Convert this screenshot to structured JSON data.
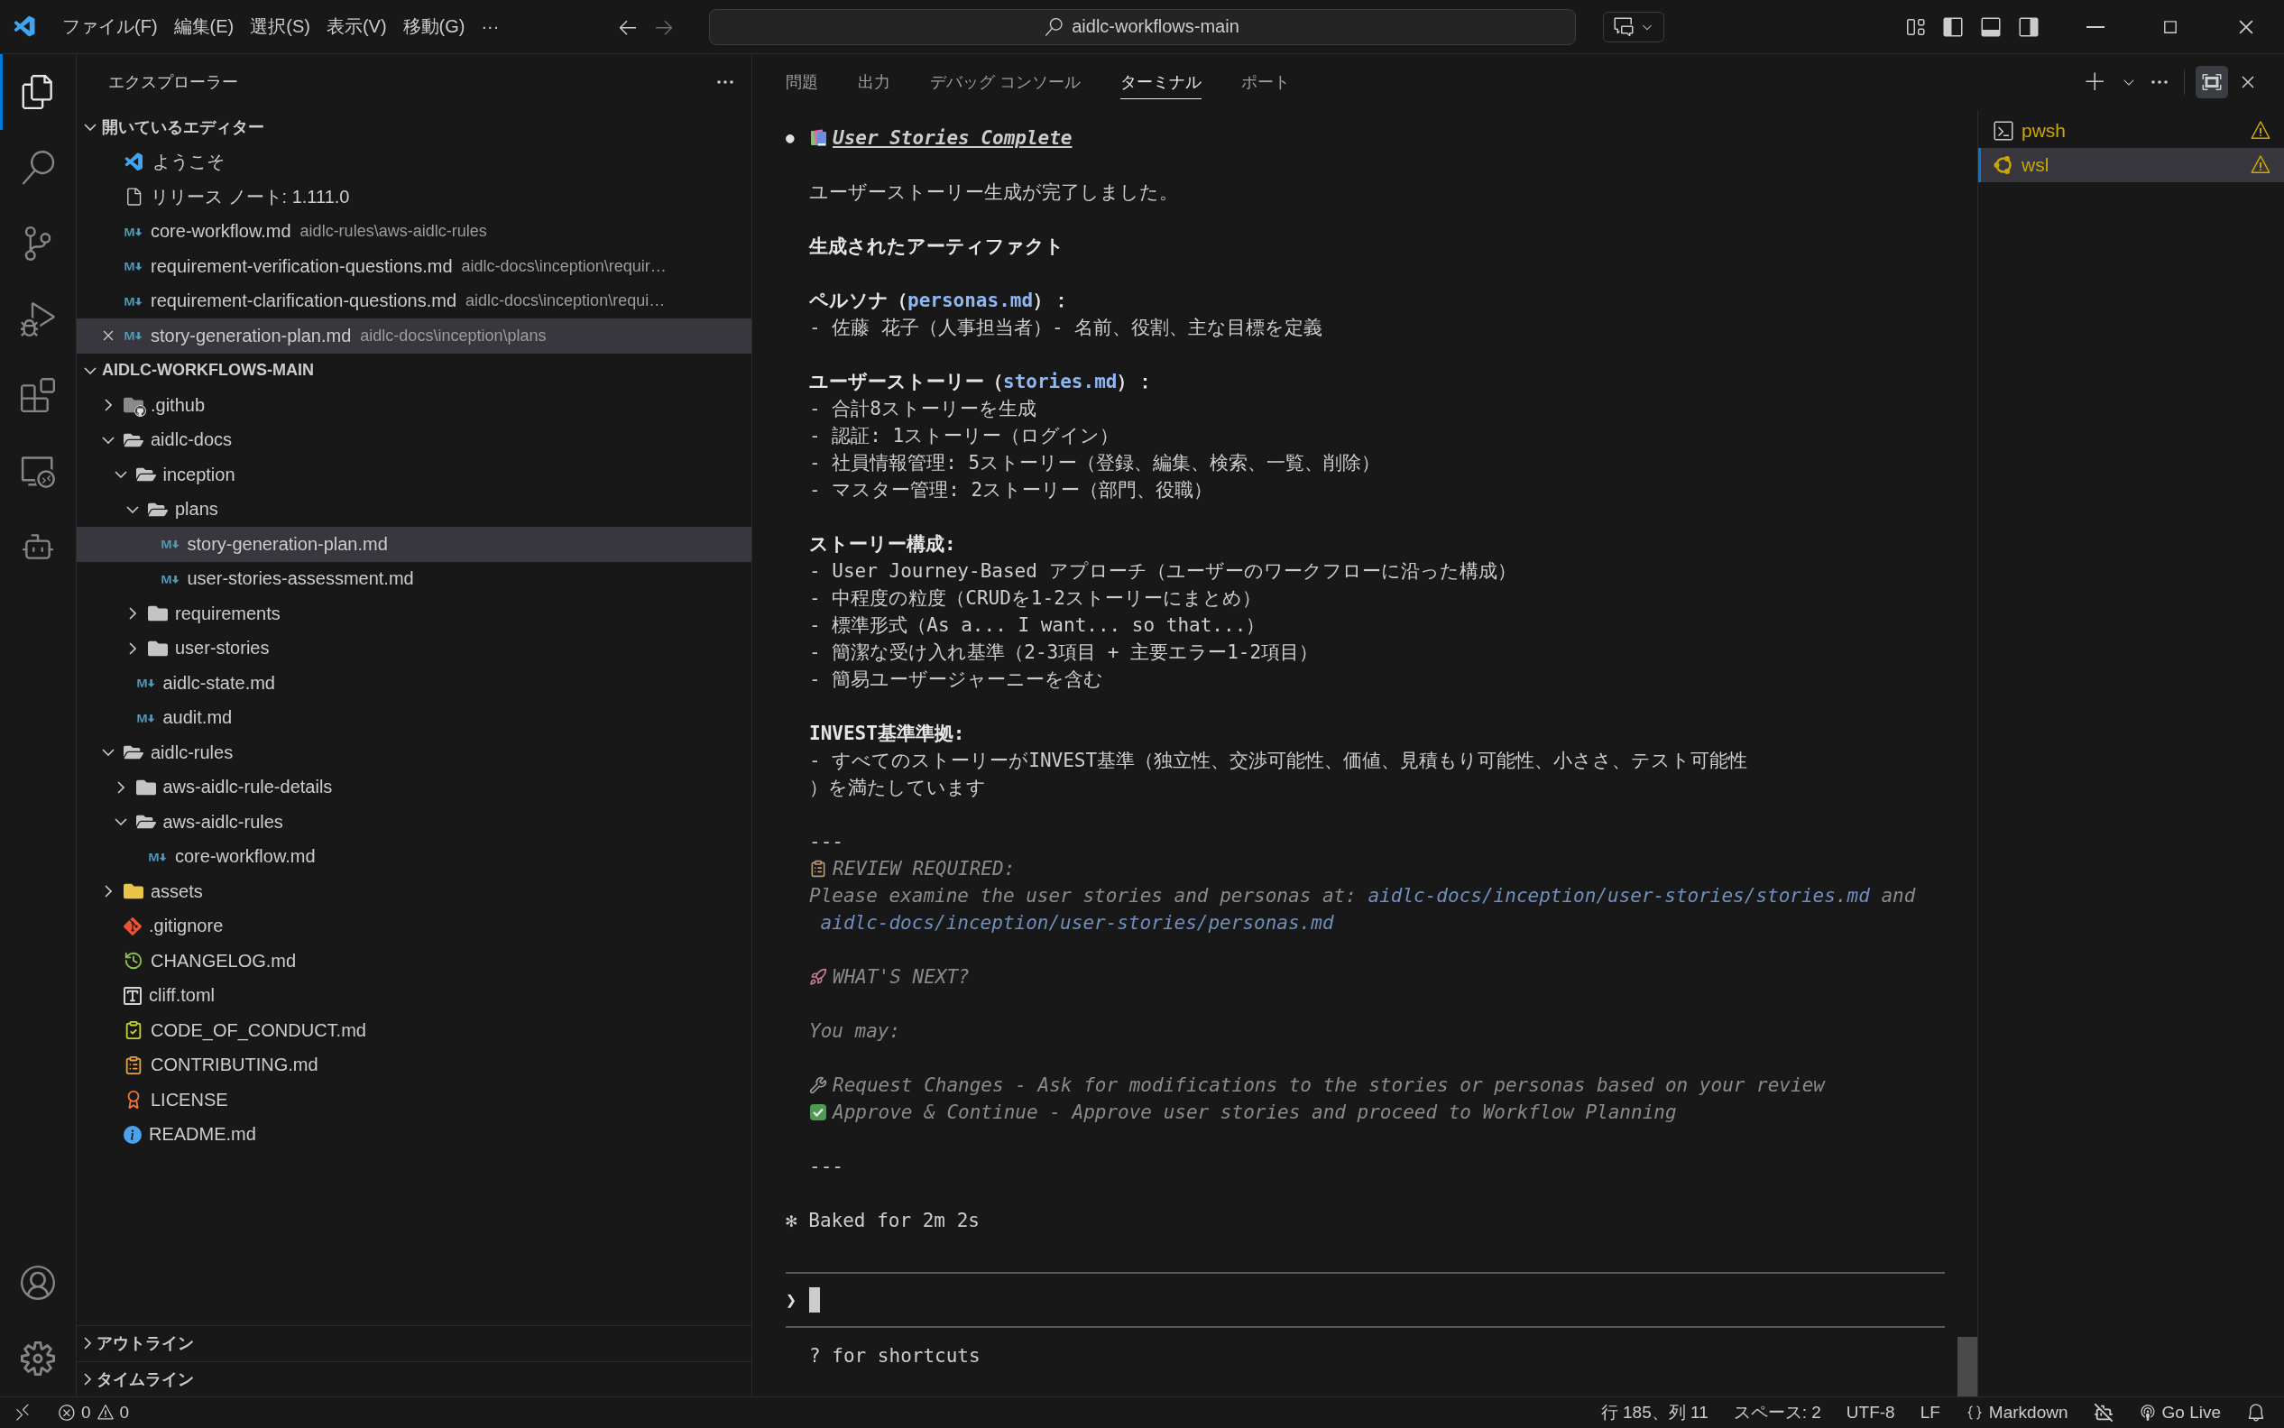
{
  "title_bar": {
    "menus": [
      "ファイル(F)",
      "編集(E)",
      "選択(S)",
      "表示(V)",
      "移動(G)"
    ],
    "more": "···",
    "search": "aidlc-workflows-main"
  },
  "activity_bar": {
    "top": [
      {
        "kind": "explorer",
        "selected": true
      },
      {
        "kind": "search",
        "selected": false
      },
      {
        "kind": "source_control",
        "selected": false
      },
      {
        "kind": "run_debug",
        "selected": false
      },
      {
        "kind": "extensions",
        "selected": false
      },
      {
        "kind": "remote",
        "selected": false
      },
      {
        "kind": "bot",
        "selected": false
      }
    ],
    "bottom": [
      {
        "kind": "account"
      },
      {
        "kind": "settings"
      }
    ]
  },
  "sidebar": {
    "title": "エクスプローラー",
    "open_editors": {
      "title": "開いているエディター",
      "expanded": true,
      "items": [
        {
          "name": "ようこそ",
          "kind": "welcome",
          "selected": false
        },
        {
          "name": "リリース ノート: 1.111.0",
          "kind": "file",
          "selected": false
        },
        {
          "name": "core-workflow.md",
          "path": "aidlc-rules\\aws-aidlc-rules",
          "kind": "markdown",
          "selected": false
        },
        {
          "name": "requirement-verification-questions.md",
          "path": "aidlc-docs\\inception\\requir…",
          "kind": "markdown",
          "selected": false
        },
        {
          "name": "requirement-clarification-questions.md",
          "path": "aidlc-docs\\inception\\requi…",
          "kind": "markdown",
          "selected": false
        },
        {
          "name": "story-generation-plan.md",
          "path": "aidlc-docs\\inception\\plans",
          "kind": "markdown",
          "selected": true
        }
      ]
    },
    "workspace": {
      "title": "AIDLC-WORKFLOWS-MAIN",
      "expanded": true,
      "items": [
        {
          "name": ".github",
          "kind": "folder_github",
          "expanded": false,
          "selected": false
        },
        {
          "name": "aidlc-docs",
          "kind": "folder",
          "expanded": true,
          "selected": false,
          "children": [
            {
              "name": "inception",
              "kind": "folder",
              "expanded": true,
              "selected": false,
              "children": [
                {
                  "name": "plans",
                  "kind": "folder",
                  "expanded": true,
                  "selected": false,
                  "children": [
                    {
                      "name": "story-generation-plan.md",
                      "kind": "markdown",
                      "selected": true
                    },
                    {
                      "name": "user-stories-assessment.md",
                      "kind": "markdown",
                      "selected": false
                    }
                  ]
                },
                {
                  "name": "requirements",
                  "kind": "folder",
                  "expanded": false,
                  "selected": false
                },
                {
                  "name": "user-stories",
                  "kind": "folder",
                  "expanded": false,
                  "selected": false
                }
              ]
            },
            {
              "name": "aidlc-state.md",
              "kind": "markdown",
              "selected": false
            },
            {
              "name": "audit.md",
              "kind": "markdown",
              "selected": false
            }
          ]
        },
        {
          "name": "aidlc-rules",
          "kind": "folder",
          "expanded": true,
          "selected": false,
          "children": [
            {
              "name": "aws-aidlc-rule-details",
              "kind": "folder",
              "expanded": false,
              "selected": false
            },
            {
              "name": "aws-aidlc-rules",
              "kind": "folder",
              "expanded": true,
              "selected": false,
              "children": [
                {
                  "name": "core-workflow.md",
                  "kind": "markdown",
                  "selected": false
                }
              ]
            }
          ]
        },
        {
          "name": "assets",
          "kind": "folder_assets",
          "expanded": false,
          "selected": false
        },
        {
          "name": ".gitignore",
          "kind": "git",
          "selected": false
        },
        {
          "name": "CHANGELOG.md",
          "kind": "changelog",
          "selected": false
        },
        {
          "name": "cliff.toml",
          "kind": "toml",
          "selected": false
        },
        {
          "name": "CODE_OF_CONDUCT.md",
          "kind": "conduct",
          "selected": false
        },
        {
          "name": "CONTRIBUTING.md",
          "kind": "contributing",
          "selected": false
        },
        {
          "name": "LICENSE",
          "kind": "license",
          "selected": false
        },
        {
          "name": "README.md",
          "kind": "readme",
          "selected": false
        }
      ]
    },
    "bottom_sections": [
      {
        "title": "アウトライン",
        "expanded": false
      },
      {
        "title": "タイムライン",
        "expanded": false
      }
    ]
  },
  "panel": {
    "tabs": [
      {
        "label": "問題",
        "selected": false
      },
      {
        "label": "出力",
        "selected": false
      },
      {
        "label": "デバッグ コンソール",
        "selected": false
      },
      {
        "label": "ターミナル",
        "selected": true
      },
      {
        "label": "ポート",
        "selected": false
      }
    ],
    "terminal": {
      "lines": [
        {
          "kind": "title",
          "bullet": "●",
          "segments": [
            {
              "text": "User Stories Complete",
              "link": false
            }
          ]
        },
        {
          "kind": "blank"
        },
        {
          "kind": "plain",
          "segments": [
            {
              "text": "ユーザーストーリー生成が完了しました。",
              "link": false
            }
          ]
        },
        {
          "kind": "blank"
        },
        {
          "kind": "bold",
          "segments": [
            {
              "text": "生成されたアーティファクト",
              "link": false
            }
          ]
        },
        {
          "kind": "blank"
        },
        {
          "kind": "bold",
          "segments": [
            {
              "text": "ペルソナ（",
              "link": false
            },
            {
              "text": "personas.md",
              "link": true
            },
            {
              "text": "）：",
              "link": false
            }
          ]
        },
        {
          "kind": "plain",
          "segments": [
            {
              "text": "- 佐藤 花子（人事担当者）- 名前、役割、主な目標を定義",
              "link": false
            }
          ]
        },
        {
          "kind": "blank"
        },
        {
          "kind": "bold",
          "segments": [
            {
              "text": "ユーザーストーリー（",
              "link": false
            },
            {
              "text": "stories.md",
              "link": true
            },
            {
              "text": "）：",
              "link": false
            }
          ]
        },
        {
          "kind": "plain",
          "segments": [
            {
              "text": "- 合計8ストーリーを生成",
              "link": false
            }
          ]
        },
        {
          "kind": "plain",
          "segments": [
            {
              "text": "- 認証: 1ストーリー（ログイン）",
              "link": false
            }
          ]
        },
        {
          "kind": "plain",
          "segments": [
            {
              "text": "- 社員情報管理: 5ストーリー（登録、編集、検索、一覧、削除）",
              "link": false
            }
          ]
        },
        {
          "kind": "plain",
          "segments": [
            {
              "text": "- マスター管理: 2ストーリー（部門、役職）",
              "link": false
            }
          ]
        },
        {
          "kind": "blank"
        },
        {
          "kind": "bold",
          "segments": [
            {
              "text": "ストーリー構成:",
              "link": false
            }
          ]
        },
        {
          "kind": "plain",
          "segments": [
            {
              "text": "- User Journey-Based アプローチ（ユーザーのワークフローに沿った構成）",
              "link": false
            }
          ]
        },
        {
          "kind": "plain",
          "segments": [
            {
              "text": "- 中程度の粒度（CRUDを1-2ストーリーにまとめ）",
              "link": false
            }
          ]
        },
        {
          "kind": "plain",
          "segments": [
            {
              "text": "- 標準形式（As a... I want... so that...）",
              "link": false
            }
          ]
        },
        {
          "kind": "plain",
          "segments": [
            {
              "text": "- 簡潔な受け入れ基準（2-3項目 + 主要エラー1-2項目）",
              "link": false
            }
          ]
        },
        {
          "kind": "plain",
          "segments": [
            {
              "text": "- 簡易ユーザージャーニーを含む",
              "link": false
            }
          ]
        },
        {
          "kind": "blank"
        },
        {
          "kind": "bold",
          "segments": [
            {
              "text": "INVEST基準準拠:",
              "link": false
            }
          ]
        },
        {
          "kind": "plain",
          "segments": [
            {
              "text": "- すべてのストーリーがINVEST基準（独立性、交渉可能性、価値、見積もり可能性、小ささ、テスト可能性",
              "link": false
            }
          ]
        },
        {
          "kind": "plain",
          "segments": [
            {
              "text": "）を満たしています",
              "link": false
            }
          ]
        },
        {
          "kind": "blank"
        },
        {
          "kind": "plain",
          "segments": [
            {
              "text": "---",
              "link": false
            }
          ]
        },
        {
          "kind": "review",
          "segments": [
            {
              "text": "REVIEW REQUIRED:",
              "link": false
            }
          ]
        },
        {
          "kind": "dim",
          "segments": [
            {
              "text": "Please examine the user stories and personas at: ",
              "link": false
            },
            {
              "text": "aidlc-docs/inception/user-stories/stories.md",
              "link": true
            },
            {
              "text": " and",
              "link": false
            }
          ]
        },
        {
          "kind": "dim_indent",
          "segments": [
            {
              "text": "aidlc-docs/inception/user-stories/personas.md",
              "link": true
            }
          ]
        },
        {
          "kind": "blank"
        },
        {
          "kind": "next",
          "segments": [
            {
              "text": "WHAT'S NEXT?",
              "link": false
            }
          ]
        },
        {
          "kind": "blank"
        },
        {
          "kind": "dim",
          "segments": [
            {
              "text": "You may:",
              "link": false
            }
          ]
        },
        {
          "kind": "blank"
        },
        {
          "kind": "change",
          "segments": [
            {
              "text": "Request Changes - Ask for modifications to the stories or personas based on your review",
              "link": false
            }
          ]
        },
        {
          "kind": "approve",
          "segments": [
            {
              "text": "Approve & Continue - Approve user stories and proceed to Workflow Planning",
              "link": false
            }
          ]
        },
        {
          "kind": "blank"
        },
        {
          "kind": "plain",
          "segments": [
            {
              "text": "---",
              "link": false
            }
          ]
        },
        {
          "kind": "blank"
        },
        {
          "kind": "status",
          "segments": [
            {
              "text": "✻ Baked for 2m 2s",
              "link": false
            }
          ]
        }
      ],
      "prompt": "❯",
      "hint": "? for shortcuts"
    },
    "terminals": [
      {
        "name": "pwsh",
        "kind": "powershell",
        "selected": false,
        "warning": true
      },
      {
        "name": "wsl",
        "kind": "linux",
        "selected": true,
        "warning": true
      }
    ]
  },
  "status_bar": {
    "errors": "0",
    "warnings": "0",
    "items": [
      {
        "kind": "position",
        "text": "行 185、列 11"
      },
      {
        "kind": "indent",
        "text": "スペース: 2"
      },
      {
        "kind": "encoding",
        "text": "UTF-8"
      },
      {
        "kind": "eol",
        "text": "LF"
      },
      {
        "kind": "language",
        "text": "Markdown"
      },
      {
        "kind": "copilot"
      },
      {
        "kind": "live",
        "text": "Go Live"
      },
      {
        "kind": "bell"
      }
    ]
  }
}
